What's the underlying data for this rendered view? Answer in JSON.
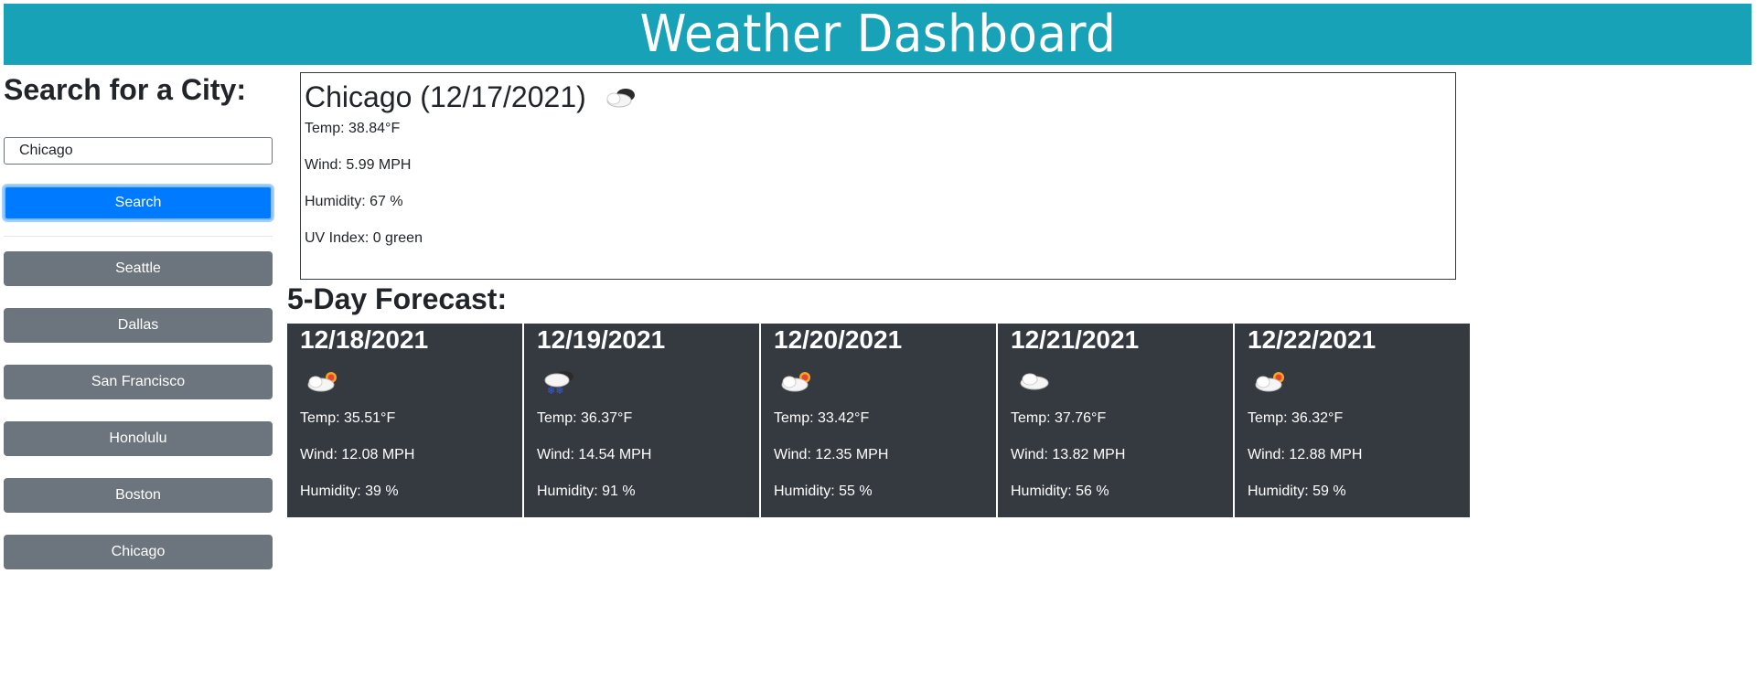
{
  "header": {
    "title": "Weather Dashboard"
  },
  "sidebar": {
    "title": "Search for a City:",
    "input_value": "Chicago",
    "search_label": "Search",
    "history": [
      "Seattle",
      "Dallas",
      "San Francisco",
      "Honolulu",
      "Boston",
      "Chicago"
    ]
  },
  "current": {
    "title": "Chicago (12/17/2021)",
    "icon": "partly-cloudy-icon",
    "temp": "Temp: 38.84°F",
    "wind": "Wind: 5.99 MPH",
    "humidity": "Humidity: 67 %",
    "uv": "UV Index: 0 green"
  },
  "forecast": {
    "title": "5-Day Forecast:",
    "days": [
      {
        "date": "12/18/2021",
        "icon": "sun-behind-cloud-icon",
        "temp": "Temp: 35.51°F",
        "wind": "Wind: 12.08 MPH",
        "humidity": "Humidity: 39 %"
      },
      {
        "date": "12/19/2021",
        "icon": "snow-cloud-icon",
        "temp": "Temp: 36.37°F",
        "wind": "Wind: 14.54 MPH",
        "humidity": "Humidity: 91 %"
      },
      {
        "date": "12/20/2021",
        "icon": "sun-behind-cloud-icon",
        "temp": "Temp: 33.42°F",
        "wind": "Wind: 12.35 MPH",
        "humidity": "Humidity: 55 %"
      },
      {
        "date": "12/21/2021",
        "icon": "cloud-icon",
        "temp": "Temp: 37.76°F",
        "wind": "Wind: 13.82 MPH",
        "humidity": "Humidity: 56 %"
      },
      {
        "date": "12/22/2021",
        "icon": "sun-behind-cloud-icon",
        "temp": "Temp: 36.32°F",
        "wind": "Wind: 12.88 MPH",
        "humidity": "Humidity: 59 %"
      }
    ]
  },
  "colors": {
    "header_bg": "#17a2b8",
    "search_button": "#007bff",
    "history_button": "#6c757d",
    "card_bg": "#343a40"
  }
}
